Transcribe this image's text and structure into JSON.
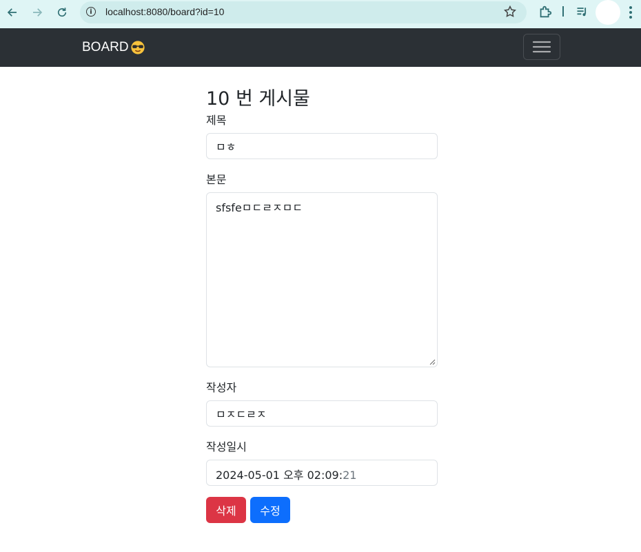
{
  "browser": {
    "url": "localhost:8080/board?id=10"
  },
  "navbar": {
    "brand": "BOARD",
    "brand_emoji_icon": "smiling-face-with-sunglasses-icon",
    "toggler_icon": "hamburger-menu-icon"
  },
  "post": {
    "heading": "10 번 게시물",
    "title_label": "제목",
    "title_value": "ㅁㅎ",
    "content_label": "본문",
    "content_value": "sfsfeㅁㄷㄹㅈㅁㄷ",
    "author_label": "작성자",
    "author_value": "ㅁㅈㄷㄹㅈ",
    "date_label": "작성일시",
    "date_value_main": "2024-05-01 오후 02:09:",
    "date_value_seconds": "21"
  },
  "actions": {
    "delete_label": "삭제",
    "edit_label": "수정"
  },
  "colors": {
    "navbar": "#2b3035",
    "danger": "#dc3545",
    "primary": "#0d6efd",
    "chrome_bg": "#dff5f5"
  }
}
